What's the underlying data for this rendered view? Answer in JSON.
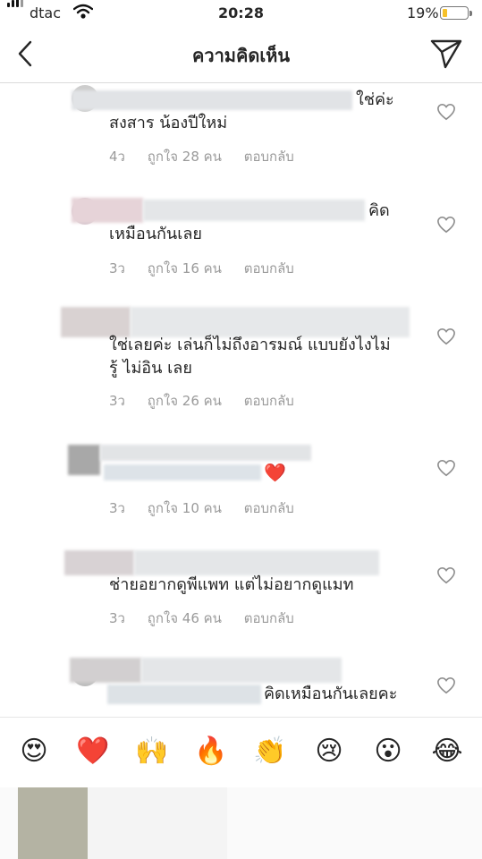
{
  "status_bar": {
    "carrier": "dtac",
    "time": "20:28",
    "battery": "19%",
    "battery_level": 0.19
  },
  "nav": {
    "title": "ความคิดเห็น"
  },
  "comments": [
    {
      "text_tail": "ใช่ค่ะ",
      "text_line2": "สงสาร น้องปีใหม่",
      "age": "4ว",
      "likes": "ถูกใจ 28 คน",
      "reply": "ตอบกลับ"
    },
    {
      "text_tail": "คิด",
      "text_line2": "เหมือนกันเลย",
      "age": "3ว",
      "likes": "ถูกใจ 16 คน",
      "reply": "ตอบกลับ"
    },
    {
      "text_line1": "ใช่เลยค่ะ เล่นก็ไม่ถึงอารมณ์ แบบยังไงไม่",
      "text_line2": "รู้ ไม่อิน เลย",
      "age": "3ว",
      "likes": "ถูกใจ 26 คน",
      "reply": "ตอบกลับ"
    },
    {
      "emoji": "❤️",
      "age": "3ว",
      "likes": "ถูกใจ 10 คน",
      "reply": "ตอบกลับ"
    },
    {
      "text_line1": "ช่ายอยากดูพีแพท แต่ไม่อยากดูแมท",
      "age": "3ว",
      "likes": "ถูกใจ 46 คน",
      "reply": "ตอบกลับ"
    },
    {
      "text_tail": "คิดเหมือนกันเลยคะ"
    }
  ],
  "emoji_bar": [
    "😍",
    "❤️",
    "🙌",
    "🔥",
    "👏",
    "😢",
    "😮",
    "😂"
  ],
  "colors": {
    "heart": "#e0202c",
    "meta_gray": "#9a9a9a",
    "divider": "#dbdbdb"
  }
}
